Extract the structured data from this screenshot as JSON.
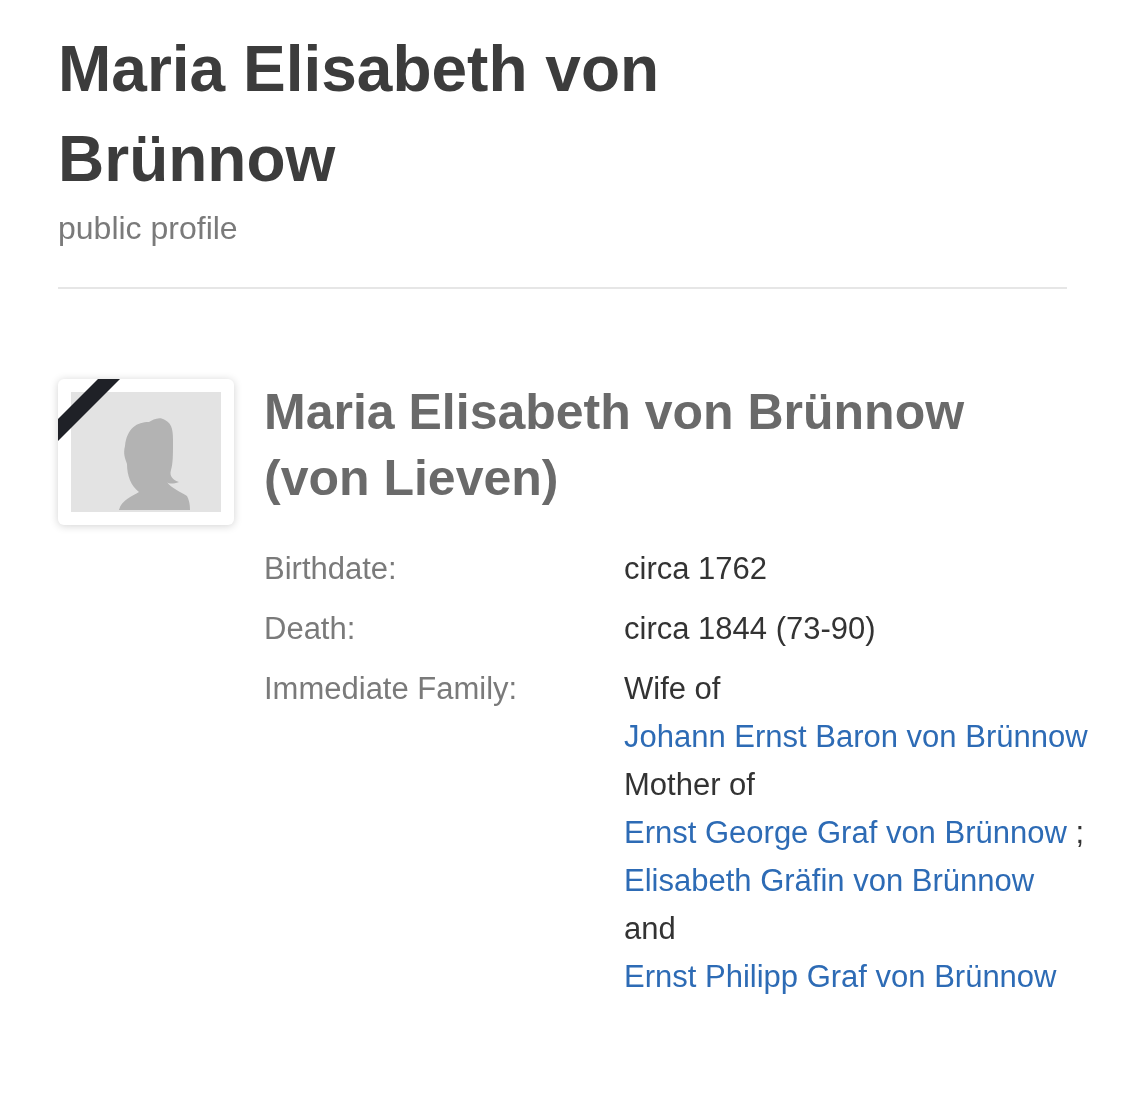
{
  "header": {
    "title": "Maria Elisabeth von Brünnow",
    "subtitle": "public profile"
  },
  "profile": {
    "deceased": true,
    "name": "Maria Elisabeth von Brünnow (von Lieven)",
    "facts": [
      {
        "label": "Birthdate:",
        "value": "circa 1762"
      },
      {
        "label": "Death:",
        "value": "circa 1844 (73-90)"
      }
    ],
    "family": {
      "label": "Immediate Family:",
      "segments": [
        {
          "kind": "text",
          "text": "Wife of"
        },
        {
          "kind": "link",
          "text": "Johann Ernst Baron von Brünnow"
        },
        {
          "kind": "break"
        },
        {
          "kind": "text",
          "text": "Mother of"
        },
        {
          "kind": "link",
          "text": "Ernst George Graf von Brünnow"
        },
        {
          "kind": "text",
          "text": ";"
        },
        {
          "kind": "link",
          "text": "Elisabeth Gräfin von Brünnow"
        },
        {
          "kind": "text",
          "text": "and"
        },
        {
          "kind": "link",
          "text": "Ernst Philipp Graf von Brünnow"
        }
      ]
    }
  }
}
